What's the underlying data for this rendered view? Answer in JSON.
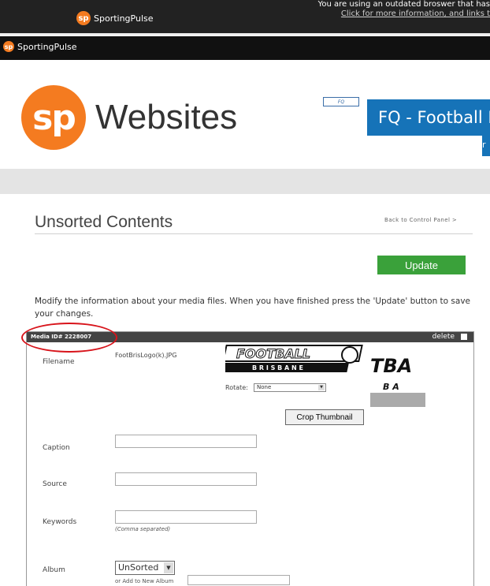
{
  "header": {
    "brand_top": "SportingPulse",
    "brand_bar": "SportingPulse",
    "warning_line1": "You are using an outdated broswer that has",
    "warning_line2": "Click for more information, and links t"
  },
  "site": {
    "logo_mark": "sp",
    "logo_text": "Websites",
    "banner_title": "FQ - Football B",
    "banner_sub": "r"
  },
  "page": {
    "title": "Unsorted Contents",
    "back_link": "Back to Control Panel >",
    "update_button": "Update",
    "intro": "Modify the information about your media files. When you have finished press the 'Update' button to save your changes."
  },
  "media": {
    "id_label": "Media ID# 2228007",
    "delete_label": "delete",
    "filename_label": "Filename",
    "filename_value": "FootBrisLogo(k).JPG",
    "rotate_label": "Rotate:",
    "rotate_value": "None",
    "crop_button": "Crop Thumbnail",
    "caption_label": "Caption",
    "source_label": "Source",
    "keywords_label": "Keywords",
    "keywords_hint": "(Comma separated)",
    "album_label": "Album",
    "album_value": "UnSorted",
    "new_album_label": "or Add to New Album",
    "logo_football": "FOOTBALL",
    "logo_brisbane": "B R I S B A N E",
    "logo_tba": "TBA",
    "logo_ba": "B A"
  },
  "colors": {
    "accent_orange": "#f47b20",
    "banner_blue": "#1673b8",
    "update_green": "#3aa13a",
    "highlight_red": "#d8141b"
  }
}
